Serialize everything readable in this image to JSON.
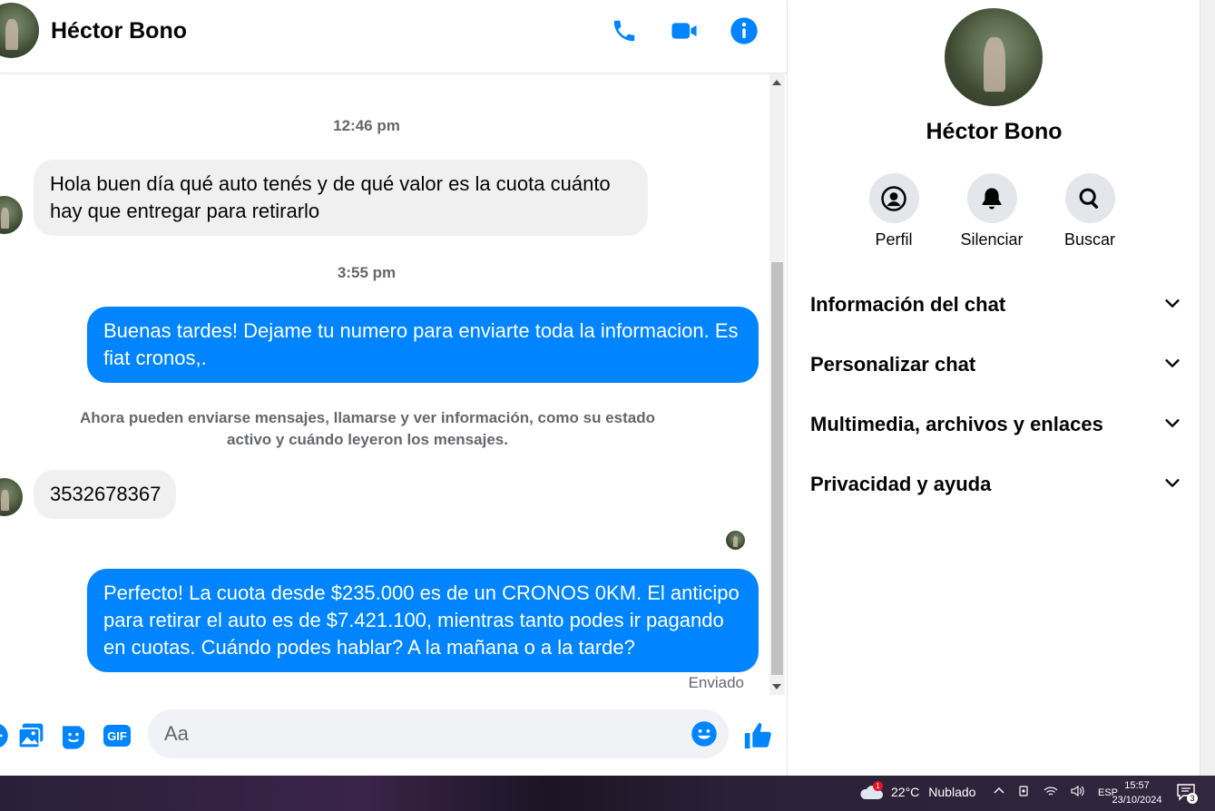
{
  "contact": {
    "name": "Héctor Bono"
  },
  "header": {
    "icons": [
      "phone-icon",
      "video-camera-icon",
      "info-icon"
    ],
    "accent": "#0084ff"
  },
  "messages": {
    "time_1": "12:46 pm",
    "msg_1": "Hola buen día qué auto tenés y de qué valor es la cuota cuánto hay que entregar para retirarlo",
    "time_2": "3:55 pm",
    "msg_2": "Buenas tardes! Dejame tu numero para enviarte toda la informacion. Es fiat cronos,.",
    "system_note": "Ahora pueden enviarse mensajes, llamarse y ver información, como su estado activo y cuándo leyeron los mensajes.",
    "msg_3": "3532678367",
    "msg_4": "Perfecto! La cuota desde $235.000 es de un CRONOS 0KM. El anticipo para retirar el auto es de $7.421.100, mientras tanto podes ir pagando en cuotas. Cuándo podes hablar? A la mañana o a la tarde?",
    "status": "Enviado"
  },
  "composer": {
    "placeholder": "Aa",
    "icons": [
      "plus-icon",
      "image-icon",
      "sticker-icon",
      "gif-icon",
      "emoji-icon",
      "like-icon"
    ],
    "gif_label": "GIF"
  },
  "info_panel": {
    "name": "Héctor Bono",
    "actions": [
      {
        "label": "Perfil",
        "icon": "profile-icon"
      },
      {
        "label": "Silenciar",
        "icon": "bell-icon"
      },
      {
        "label": "Buscar",
        "icon": "search-icon"
      }
    ],
    "sections": [
      "Información del chat",
      "Personalizar chat",
      "Multimedia, archivos y enlaces",
      "Privacidad y ayuda"
    ]
  },
  "taskbar": {
    "weather": "22°C",
    "weather_text": "Nublado",
    "weather_badge": "1",
    "language": "ESP",
    "time": "15:57",
    "date": "23/10/2024",
    "notifications": "3"
  }
}
